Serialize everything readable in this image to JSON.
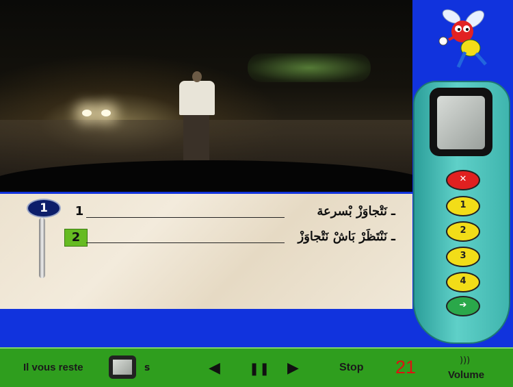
{
  "question": {
    "number": "1",
    "answers": [
      {
        "num": "1",
        "text": "نَتْجاوَزْ بْسرعة",
        "selected": false
      },
      {
        "num": "2",
        "text": "نَنْتَظَرْ بَاشْ نَتْجاوَزْ",
        "selected": true
      }
    ],
    "bullet": "ـ"
  },
  "remote": {
    "cancel_label": "✕",
    "buttons": [
      "1",
      "2",
      "3",
      "4"
    ],
    "confirm_label": "➔"
  },
  "footer": {
    "remaining_label": "Il vous reste",
    "remaining_unit": "s",
    "prev_label": "◀",
    "pause_label": "❚❚",
    "next_label": "▶",
    "stop_label": "Stop",
    "counter": "21",
    "volume_icon": ")))",
    "volume_label": "Volume"
  },
  "colors": {
    "background": "#1133dd",
    "selected_answer": "#66bb22",
    "counter": "#dd1111",
    "remote_body": "#3fb5ae"
  }
}
